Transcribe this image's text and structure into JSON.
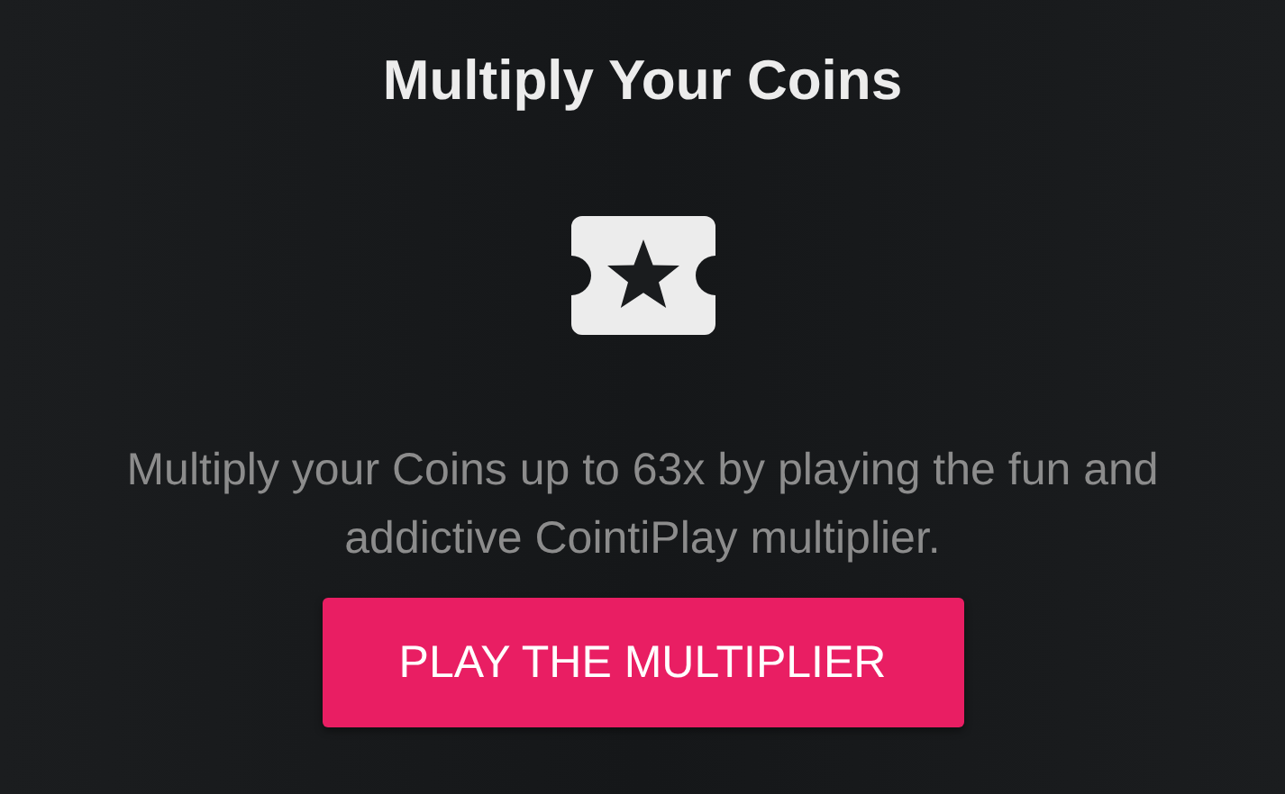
{
  "title": "Multiply Your Coins",
  "description": "Multiply your Coins up to 63x by playing the fun and addictive CointiPlay multiplier.",
  "button": {
    "label": "PLAY THE MULTIPLIER"
  }
}
